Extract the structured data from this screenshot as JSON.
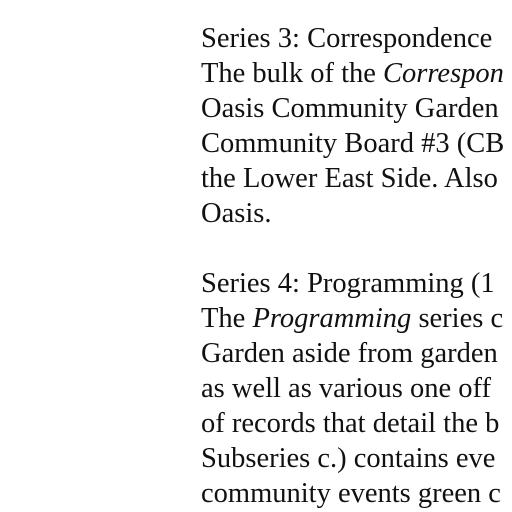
{
  "document": {
    "series3": {
      "heading": "Series 3: Correspondence",
      "line1_pre": "The bulk of the ",
      "line1_italic": "Correspon",
      "line2": "Oasis Community Garden",
      "line3": "Community Board #3 (CB",
      "line4": "the Lower East Side. Also",
      "line5": "Oasis."
    },
    "series4": {
      "heading": "Series 4: Programming (1",
      "line1_pre": "The ",
      "line1_italic": "Programming",
      "line1_post": " series c",
      "line2": "Garden aside from garden",
      "line3": "as well as various one off",
      "line4": "of records that detail the b",
      "line5": "Subseries c.) contains eve",
      "line6": "community events green c"
    }
  }
}
